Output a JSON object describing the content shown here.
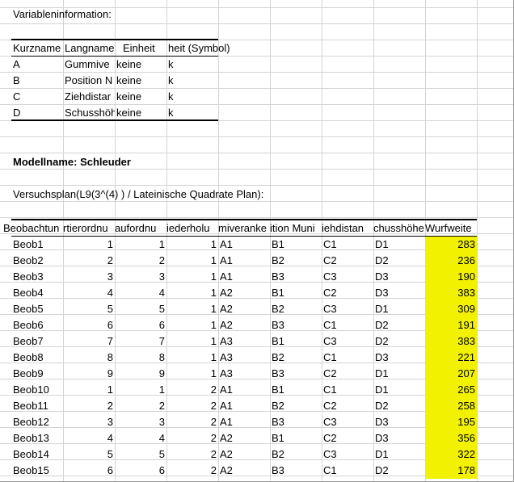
{
  "title": "Variableninformation:",
  "variables": {
    "headers": [
      "Kurzname",
      "Langname",
      "Einheit",
      "heit (Symbol)"
    ],
    "rows": [
      [
        "A",
        "Gummive",
        "keine",
        "k"
      ],
      [
        "B",
        "Position N",
        "keine",
        "k"
      ],
      [
        "C",
        "Ziehdistar",
        "keine",
        "k"
      ],
      [
        "D",
        "Schusshöh",
        "keine",
        "k"
      ]
    ]
  },
  "model_label": "Modellname: Schleuder",
  "plan_label": "Versuchsplan(L9(3^(4) ) /  Lateinische Quadrate Plan):",
  "plan": {
    "headers": [
      "Beobachtun",
      "rtierordnu",
      "aufordnu",
      "iederholu",
      "miveranke",
      "ition Muni",
      "iehdistan",
      "chusshöhe",
      "Wurfweite"
    ],
    "rows": [
      [
        "Beob1",
        "1",
        "1",
        "1",
        "A1",
        "B1",
        "C1",
        "D1",
        "283"
      ],
      [
        "Beob2",
        "2",
        "2",
        "1",
        "A1",
        "B2",
        "C2",
        "D2",
        "236"
      ],
      [
        "Beob3",
        "3",
        "3",
        "1",
        "A1",
        "B3",
        "C3",
        "D3",
        "190"
      ],
      [
        "Beob4",
        "4",
        "4",
        "1",
        "A2",
        "B1",
        "C2",
        "D3",
        "383"
      ],
      [
        "Beob5",
        "5",
        "5",
        "1",
        "A2",
        "B2",
        "C3",
        "D1",
        "309"
      ],
      [
        "Beob6",
        "6",
        "6",
        "1",
        "A2",
        "B3",
        "C1",
        "D2",
        "191"
      ],
      [
        "Beob7",
        "7",
        "7",
        "1",
        "A3",
        "B1",
        "C3",
        "D2",
        "383"
      ],
      [
        "Beob8",
        "8",
        "8",
        "1",
        "A3",
        "B2",
        "C1",
        "D3",
        "221"
      ],
      [
        "Beob9",
        "9",
        "9",
        "1",
        "A3",
        "B3",
        "C2",
        "D1",
        "207"
      ],
      [
        "Beob10",
        "1",
        "1",
        "2",
        "A1",
        "B1",
        "C1",
        "D1",
        "265"
      ],
      [
        "Beob11",
        "2",
        "2",
        "2",
        "A1",
        "B2",
        "C2",
        "D2",
        "258"
      ],
      [
        "Beob12",
        "3",
        "3",
        "2",
        "A1",
        "B3",
        "C3",
        "D3",
        "195"
      ],
      [
        "Beob13",
        "4",
        "4",
        "2",
        "A2",
        "B1",
        "C2",
        "D3",
        "356"
      ],
      [
        "Beob14",
        "5",
        "5",
        "2",
        "A2",
        "B2",
        "C3",
        "D1",
        "322"
      ],
      [
        "Beob15",
        "6",
        "6",
        "2",
        "A2",
        "B3",
        "C1",
        "D2",
        "178"
      ]
    ]
  },
  "colors": {
    "highlight": "#f2f200",
    "gridline": "#d4d4d4"
  }
}
